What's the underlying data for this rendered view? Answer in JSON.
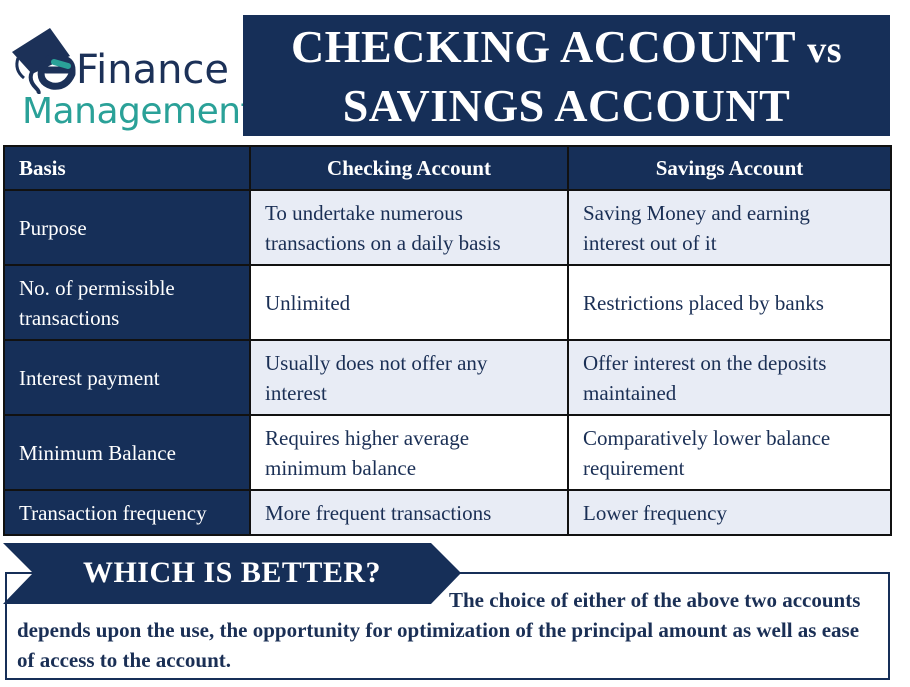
{
  "logo": {
    "brand_line1": "Finance",
    "brand_line2": "Management",
    "icon": "graduation-cap-e-icon",
    "colors": {
      "navy": "#1c3158",
      "teal": "#2aa198"
    }
  },
  "title": {
    "line1_main": "CHECKING ACCOUNT",
    "line1_vs": "vs",
    "line2": "SAVINGS ACCOUNT"
  },
  "table": {
    "headers": [
      "Basis",
      "Checking Account",
      "Savings Account"
    ],
    "rows": [
      {
        "basis": "Purpose",
        "checking": "To undertake numerous transactions on a daily basis",
        "savings": "Saving Money and earning interest out of it"
      },
      {
        "basis": "No. of permissible transactions",
        "checking": "Unlimited",
        "savings": "Restrictions placed by banks"
      },
      {
        "basis": "Interest payment",
        "checking": "Usually does not offer any interest",
        "savings": "Offer interest on the deposits maintained"
      },
      {
        "basis": "Minimum Balance",
        "checking": "Requires higher average minimum balance",
        "savings": "Comparatively lower balance requirement"
      },
      {
        "basis": "Transaction frequency",
        "checking": "More frequent transactions",
        "savings": "Lower frequency"
      }
    ]
  },
  "which_is_better": {
    "heading": "WHICH IS BETTER?",
    "text": "The choice of either of the above two accounts depends upon the use, the opportunity for optimization of the principal amount as well as ease of access to the account."
  },
  "colors": {
    "navy": "#162f58",
    "light_row": "#e8ecf5",
    "border": "#111111"
  }
}
